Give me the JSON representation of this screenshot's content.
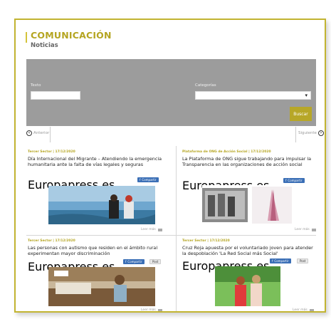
{
  "header": {
    "title": "COMUNICACIÓN",
    "subtitle": "Noticias"
  },
  "filter": {
    "text_label": "Texto",
    "text_value": "",
    "category_label": "Categorías",
    "category_value": "",
    "search_label": "Buscar"
  },
  "pager": {
    "prev": "Anterior",
    "next": "Siguiente"
  },
  "cards": [
    {
      "date": "Tercer Sector | 17/12/2020",
      "headline": "Día Internacional del Migrante – Atendiendo la emergencia humanitaria ante la falta de vías legales y seguras",
      "source": "Europapress.es",
      "share": "Compartir",
      "more": "Leer más"
    },
    {
      "date": "Plataforma de ONG de Acción Social | 17/12/2020",
      "headline": "La Plataforma de ONG sigue trabajando para impulsar la Transparencia en las organizaciones de acción social",
      "source": "Europapress.es",
      "share": "Compartir",
      "more": "Leer más"
    },
    {
      "date": "Tercer Sector | 17/12/2020",
      "headline": "Las personas con autismo que residen en el ámbito rural experimentan mayor discriminación",
      "source": "Europapress.es",
      "share": "Compartir",
      "tweet": "Post",
      "more": "Leer más"
    },
    {
      "date": "Tercer Sector | 17/12/2020",
      "headline": "Cruz Roja apuesta por el voluntariado joven para atender la despoblación 'La Red Social más Social'",
      "source": "Europapress.es",
      "share": "Compartir",
      "tweet": "Post",
      "more": "Leer más"
    }
  ],
  "colors": {
    "accent": "#b5a521",
    "filter_bg": "#9c9c9c",
    "share_blue": "#3b6fb6"
  }
}
